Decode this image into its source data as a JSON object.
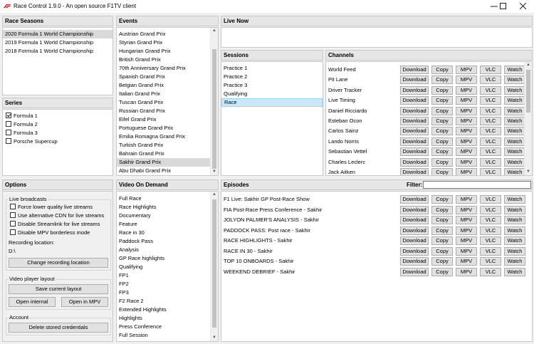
{
  "window": {
    "title": "Race Control 1.9.0 - An open source F1TV client",
    "minimize": "—",
    "maximize": "□",
    "close": "✕"
  },
  "race_seasons": {
    "header": "Race Seasons",
    "items": [
      "2020 Formula 1 World Championship",
      "2019 Formula 1 World Championship",
      "2018 Formula 1 World Championship"
    ]
  },
  "series": {
    "header": "Series",
    "items": [
      {
        "label": "Formula 1",
        "checked": true
      },
      {
        "label": "Formula 2",
        "checked": false
      },
      {
        "label": "Formula 3",
        "checked": false
      },
      {
        "label": "Porsche Supercup",
        "checked": false
      }
    ]
  },
  "events": {
    "header": "Events",
    "items": [
      "Austrian Grand Prix",
      "Styrian Grand Prix",
      "Hungarian Grand Prix",
      "British Grand Prix",
      "70th Anniversary Grand Prix",
      "Spanish Grand Prix",
      "Belgian Grand Prix",
      "Italian Grand Prix",
      "Tuscan Grand Prix",
      "Russian Grand Prix",
      "Eifel Grand Prix",
      "Portuguese Grand Prix",
      "Emilia Romagna Grand Prix",
      "Turkish Grand Prix",
      "Bahrain Grand Prix",
      "Sakhir Grand Prix",
      "Abu Dhabi Grand Prix"
    ]
  },
  "live_now": {
    "header": "Live Now"
  },
  "sessions": {
    "header": "Sessions",
    "items": [
      "Practice 1",
      "Practice 2",
      "Practice 3",
      "Qualifying",
      "Race"
    ]
  },
  "channels": {
    "header": "Channels",
    "items": [
      "World Feed",
      "Pit Lane",
      "Driver Tracker",
      "Live Timing",
      "Daniel Ricciardo",
      "Esteban Ocon",
      "Carlos Sainz",
      "Lando Norris",
      "Sebastian Vettel",
      "Charles Leclerc",
      "Jack Aitken"
    ]
  },
  "actions": {
    "download": "Download",
    "copy": "Copy",
    "mpv": "MPV",
    "vlc": "VLC",
    "watch": "Watch"
  },
  "options": {
    "header": "Options",
    "live_broadcasts": "Live broadcasts",
    "checks": [
      {
        "label": "Force lower quality live streams",
        "checked": false
      },
      {
        "label": "Use alternative CDN for live streams",
        "checked": false
      },
      {
        "label": "Disable Streamlink for live streams",
        "checked": false
      },
      {
        "label": "Disable MPV borderless mode",
        "checked": false
      }
    ],
    "recording_location_label": "Recording location:",
    "recording_location_value": "D:\\",
    "change_recording_location": "Change recording location",
    "video_player_layout": "Video player layout",
    "save_current_layout": "Save current layout",
    "open_internal": "Open internal",
    "open_in_mpv": "Open in MPV",
    "account": "Account",
    "delete_credentials": "Delete stored credentials"
  },
  "vod": {
    "header": "Video On Demand",
    "items": [
      "Full Race",
      "Race Highlights",
      "Documentary",
      "Feature",
      "Race in 30",
      "Paddock Pass",
      "Analysis",
      "GP Race highlights",
      "Qualifying",
      "FP1",
      "FP2",
      "FP3",
      "F2 Race 2",
      "Extended Highlights",
      "Highlights",
      "Press Conference",
      "Full Session"
    ]
  },
  "episodes": {
    "header": "Episodes",
    "filter_label": "Filter:",
    "filter_value": "",
    "items": [
      "F1 Live: Sakhir GP Post-Race Show",
      "FIA Post-Race Press Conference - Sakhir",
      "JOLYON PALMER'S ANALYSIS - Sakhir",
      "PADDOCK PASS:  Post race - Sakhir",
      "RACE HIGHLIGHTS - Sakhir",
      "RACE IN 30 - Sakhir",
      "TOP 10 ONBOARDS - Sakhir",
      "WEEKEND DEBRIEF - Sakhir"
    ]
  }
}
